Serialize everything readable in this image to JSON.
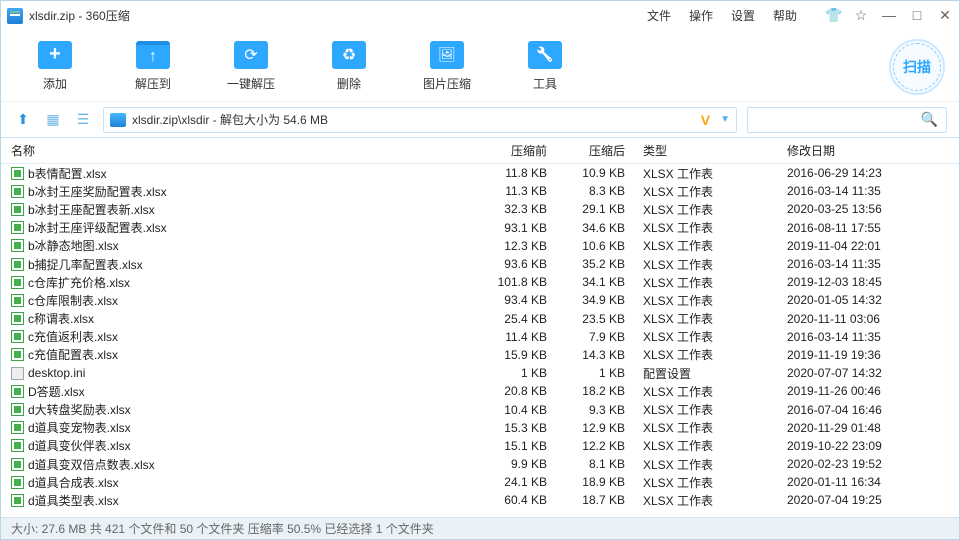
{
  "titlebar": {
    "title": "xlsdir.zip - 360压缩"
  },
  "menubar": {
    "file": "文件",
    "operate": "操作",
    "settings": "设置",
    "help": "帮助"
  },
  "winicons": {
    "shirt": "👕",
    "fav": "☆",
    "min": "—",
    "max": "□",
    "close": "✕"
  },
  "toolbar": {
    "add": "添加",
    "extract": "解压到",
    "onekey": "一键解压",
    "delete": "删除",
    "imgzip": "图片压缩",
    "tools": "工具",
    "scan": "扫描"
  },
  "path": {
    "text": "xlsdir.zip\\xlsdir - 解包大小为 54.6 MB"
  },
  "headers": {
    "name": "名称",
    "before": "压缩前",
    "after": "压缩后",
    "type": "类型",
    "date": "修改日期"
  },
  "filetypes": {
    "xlsx": "XLSX 工作表",
    "ini": "配置设置"
  },
  "files": [
    {
      "n": "b表情配置.xlsx",
      "b": "11.8 KB",
      "a": "10.9 KB",
      "t": "xlsx",
      "d": "2016-06-29 14:23"
    },
    {
      "n": "b冰封王座奖励配置表.xlsx",
      "b": "11.3 KB",
      "a": "8.3 KB",
      "t": "xlsx",
      "d": "2016-03-14 11:35"
    },
    {
      "n": "b冰封王座配置表新.xlsx",
      "b": "32.3 KB",
      "a": "29.1 KB",
      "t": "xlsx",
      "d": "2020-03-25 13:56"
    },
    {
      "n": "b冰封王座评级配置表.xlsx",
      "b": "93.1 KB",
      "a": "34.6 KB",
      "t": "xlsx",
      "d": "2016-08-11 17:55"
    },
    {
      "n": "b冰静态地图.xlsx",
      "b": "12.3 KB",
      "a": "10.6 KB",
      "t": "xlsx",
      "d": "2019-11-04 22:01"
    },
    {
      "n": "b捕捉几率配置表.xlsx",
      "b": "93.6 KB",
      "a": "35.2 KB",
      "t": "xlsx",
      "d": "2016-03-14 11:35"
    },
    {
      "n": "c仓库扩充价格.xlsx",
      "b": "101.8 KB",
      "a": "34.1 KB",
      "t": "xlsx",
      "d": "2019-12-03 18:45"
    },
    {
      "n": "c仓库限制表.xlsx",
      "b": "93.4 KB",
      "a": "34.9 KB",
      "t": "xlsx",
      "d": "2020-01-05 14:32"
    },
    {
      "n": "c称谓表.xlsx",
      "b": "25.4 KB",
      "a": "23.5 KB",
      "t": "xlsx",
      "d": "2020-11-11 03:06"
    },
    {
      "n": "c充值返利表.xlsx",
      "b": "11.4 KB",
      "a": "7.9 KB",
      "t": "xlsx",
      "d": "2016-03-14 11:35"
    },
    {
      "n": "c充值配置表.xlsx",
      "b": "15.9 KB",
      "a": "14.3 KB",
      "t": "xlsx",
      "d": "2019-11-19 19:36"
    },
    {
      "n": "desktop.ini",
      "b": "1 KB",
      "a": "1 KB",
      "t": "ini",
      "d": "2020-07-07 14:32"
    },
    {
      "n": "D答题.xlsx",
      "b": "20.8 KB",
      "a": "18.2 KB",
      "t": "xlsx",
      "d": "2019-11-26 00:46"
    },
    {
      "n": "d大转盘奖励表.xlsx",
      "b": "10.4 KB",
      "a": "9.3 KB",
      "t": "xlsx",
      "d": "2016-07-04 16:46"
    },
    {
      "n": "d道具变宠物表.xlsx",
      "b": "15.3 KB",
      "a": "12.9 KB",
      "t": "xlsx",
      "d": "2020-11-29 01:48"
    },
    {
      "n": "d道具变伙伴表.xlsx",
      "b": "15.1 KB",
      "a": "12.2 KB",
      "t": "xlsx",
      "d": "2019-10-22 23:09"
    },
    {
      "n": "d道具变双倍点数表.xlsx",
      "b": "9.9 KB",
      "a": "8.1 KB",
      "t": "xlsx",
      "d": "2020-02-23 19:52"
    },
    {
      "n": "d道具合成表.xlsx",
      "b": "24.1 KB",
      "a": "18.9 KB",
      "t": "xlsx",
      "d": "2020-01-11 16:34"
    },
    {
      "n": "d道具类型表.xlsx",
      "b": "60.4 KB",
      "a": "18.7 KB",
      "t": "xlsx",
      "d": "2020-07-04 19:25"
    }
  ],
  "status": "大小: 27.6 MB 共 421 个文件和 50 个文件夹 压缩率 50.5% 已经选择 1 个文件夹"
}
